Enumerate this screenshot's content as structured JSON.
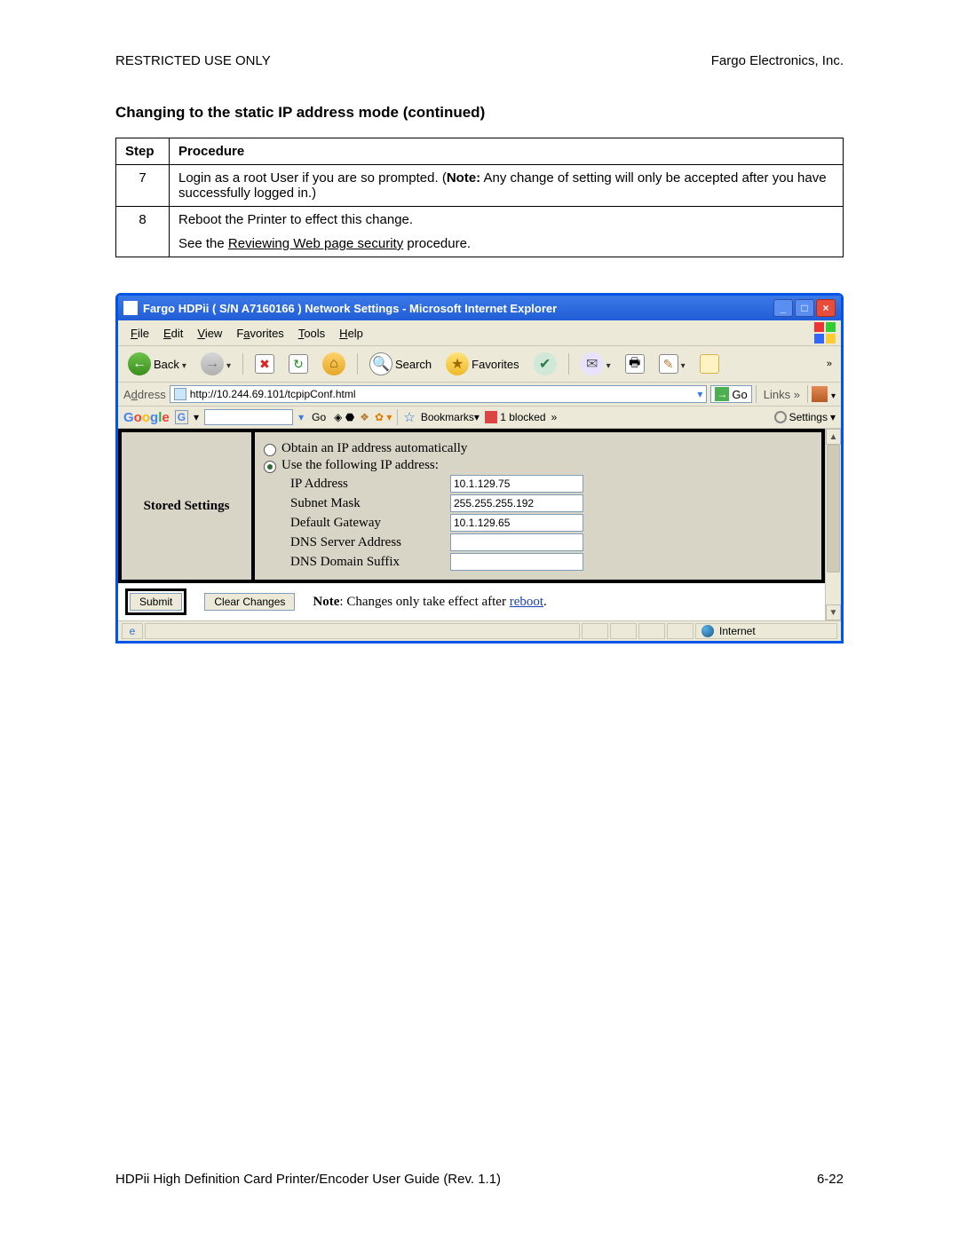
{
  "header": {
    "restricted": "RESTRICTED USE ONLY",
    "company": "Fargo Electronics, Inc."
  },
  "section_title": "Changing to the static IP address mode (continued)",
  "table": {
    "col_step": "Step",
    "col_proc": "Procedure",
    "rows": [
      {
        "n": "7",
        "text_a": "Login as a root User if you are so prompted. (",
        "bold": "Note:",
        "text_b": "  Any change of setting will only be accepted after you have successfully logged in.)"
      },
      {
        "n": "8",
        "line1": "Reboot the Printer to effect this change.",
        "line2a": "See the ",
        "line2u": "Reviewing Web page security",
        "line2b": " procedure."
      }
    ]
  },
  "window": {
    "title": "Fargo HDPii ( S/N A7160166 ) Network Settings - Microsoft Internet Explorer",
    "menu": {
      "file": "File",
      "edit": "Edit",
      "view": "View",
      "fav": "Favorites",
      "tools": "Tools",
      "help": "Help"
    },
    "toolbar": {
      "back": "Back",
      "search": "Search",
      "favorites": "Favorites",
      "overflow": "»"
    },
    "address": {
      "label": "Address",
      "url": "http://10.244.69.101/tcpipConf.html",
      "go": "Go",
      "links": "Links",
      "linksmore": "»"
    },
    "google": {
      "go": "Go",
      "bookmarks": "Bookmarks",
      "blocked": "1 blocked",
      "more": "»",
      "settings": "Settings"
    },
    "content": {
      "stored": "Stored Settings",
      "opt_auto": "Obtain an IP address automatically",
      "opt_static": "Use the following IP address:",
      "fields": {
        "ip_lbl": "IP Address",
        "ip_val": "10.1.129.75",
        "mask_lbl": "Subnet Mask",
        "mask_val": "255.255.255.192",
        "gw_lbl": "Default Gateway",
        "gw_val": "10.1.129.65",
        "dns_lbl": "DNS Server Address",
        "dns_val": "",
        "suf_lbl": "DNS Domain Suffix",
        "suf_val": ""
      },
      "submit": "Submit",
      "clear": "Clear Changes",
      "note_b": "Note",
      "note_t": ": Changes only take effect after ",
      "note_link": "reboot",
      "note_end": "."
    },
    "status": {
      "zone": "Internet"
    }
  },
  "footer": {
    "left": "HDPii High Definition Card Printer/Encoder User Guide (Rev. 1.1)",
    "right": "6-22"
  }
}
